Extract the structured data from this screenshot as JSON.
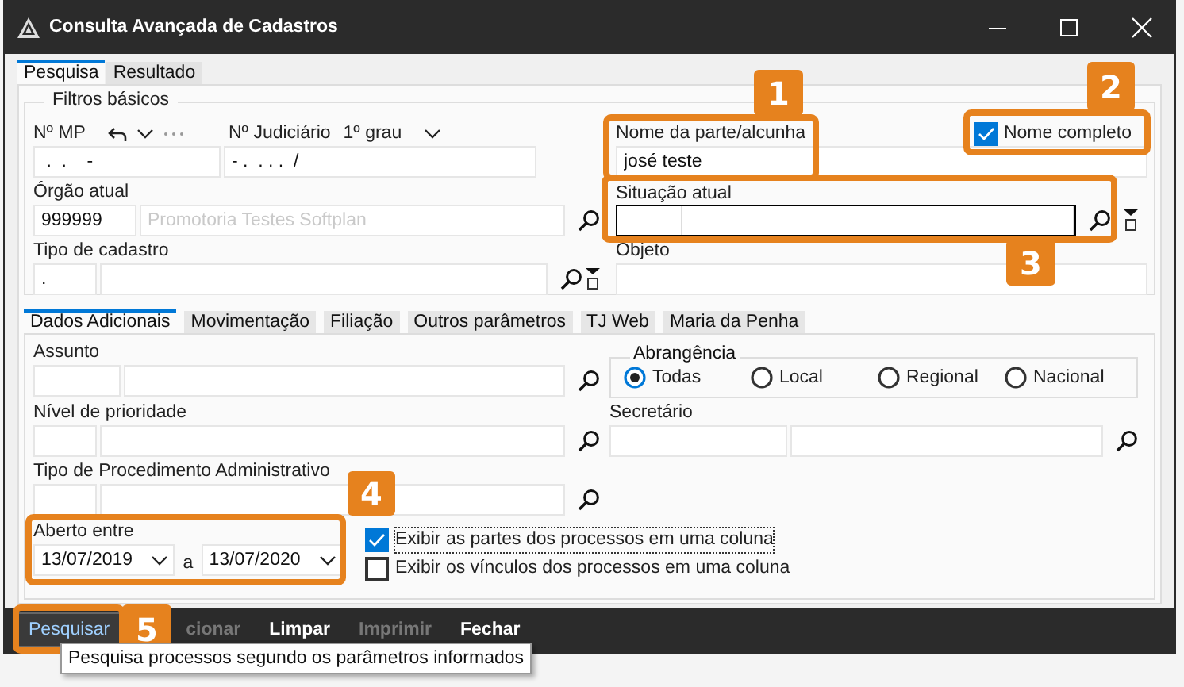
{
  "window": {
    "title": "Consulta Avançada de Cadastros"
  },
  "tabs": [
    {
      "label": "Pesquisa",
      "selected": true
    },
    {
      "label": "Resultado",
      "selected": false
    }
  ],
  "basic_filters": {
    "title": "Filtros básicos",
    "mp": {
      "label": "Nº MP",
      "value": " .  .    -"
    },
    "judicial": {
      "label": "Nº Judiciário",
      "instance": "1º grau",
      "value": "- .  . . .  /"
    },
    "orgao": {
      "label": "Órgão atual",
      "code": "999999",
      "name": "Promotoria Testes Softplan"
    },
    "tipo": {
      "label": "Tipo de cadastro",
      "code": "."
    },
    "nome": {
      "label": "Nome da parte/alcunha",
      "value": "josé teste"
    },
    "nome_completo": {
      "label": "Nome completo",
      "checked": true
    },
    "situacao": {
      "label": "Situação atual",
      "focused": true
    },
    "objeto": {
      "label": "Objeto"
    }
  },
  "sub_tabs": [
    {
      "label": "Dados Adicionais",
      "selected": true
    },
    {
      "label": "Movimentação",
      "selected": false
    },
    {
      "label": "Filiação",
      "selected": false
    },
    {
      "label": "Outros parâmetros",
      "selected": false
    },
    {
      "label": "TJ Web",
      "selected": false
    },
    {
      "label": "Maria da Penha",
      "selected": false
    }
  ],
  "additional": {
    "assunto": {
      "label": "Assunto"
    },
    "nivel": {
      "label": "Nível de prioridade"
    },
    "procedimento": {
      "label": "Tipo de Procedimento Administrativo"
    },
    "abrangencia": {
      "title": "Abrangência",
      "options": [
        {
          "label": "Todas",
          "selected": true
        },
        {
          "label": "Local",
          "selected": false
        },
        {
          "label": "Regional",
          "selected": false
        },
        {
          "label": "Nacional",
          "selected": false
        }
      ]
    },
    "secretario": {
      "label": "Secretário"
    },
    "aberto_entre": {
      "label": "Aberto entre",
      "from": "13/07/2019",
      "separator": "a",
      "to": "13/07/2020"
    },
    "options": [
      {
        "label": "Exibir as partes dos processos em uma coluna",
        "checked": true,
        "focused": true
      },
      {
        "label": "Exibir os vínculos dos processos em uma coluna",
        "checked": false,
        "focused": false
      }
    ]
  },
  "buttons": [
    {
      "label": "Pesquisar",
      "disabled": false,
      "focused": true
    },
    {
      "label": "cionar",
      "disabled": true,
      "focused": false
    },
    {
      "label": "Limpar",
      "disabled": false,
      "focused": false
    },
    {
      "label": "Imprimir",
      "disabled": true,
      "focused": false
    },
    {
      "label": "Fechar",
      "disabled": false,
      "focused": false
    }
  ],
  "tooltip": "Pesquisa processos segundo os parâmetros informados",
  "callouts": [
    "1",
    "2",
    "3",
    "4",
    "5"
  ]
}
